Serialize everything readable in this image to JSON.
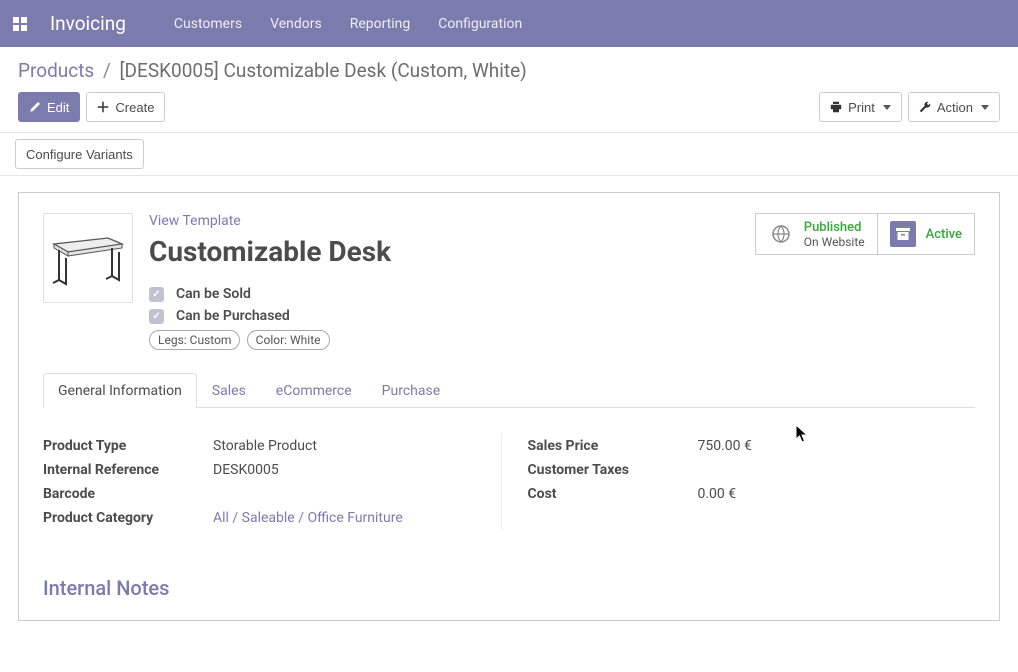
{
  "nav": {
    "brand": "Invoicing",
    "items": [
      "Customers",
      "Vendors",
      "Reporting",
      "Configuration"
    ]
  },
  "breadcrumb": {
    "parent": "Products",
    "current": "[DESK0005] Customizable Desk (Custom, White)"
  },
  "buttons": {
    "edit": "Edit",
    "create": "Create",
    "print": "Print",
    "action": "Action",
    "configure_variants": "Configure Variants"
  },
  "product": {
    "view_template": "View Template",
    "title": "Customizable Desk",
    "can_be_sold": "Can be Sold",
    "can_be_purchased": "Can be Purchased",
    "tags": [
      "Legs: Custom",
      "Color: White"
    ]
  },
  "status": {
    "published": {
      "line1": "Published",
      "line2": "On Website"
    },
    "active": {
      "line1": "Active"
    }
  },
  "tabs": [
    "General Information",
    "Sales",
    "eCommerce",
    "Purchase"
  ],
  "fields_left": {
    "product_type": {
      "label": "Product Type",
      "value": "Storable Product"
    },
    "internal_ref": {
      "label": "Internal Reference",
      "value": "DESK0005"
    },
    "barcode": {
      "label": "Barcode",
      "value": ""
    },
    "category": {
      "label": "Product Category",
      "value": "All / Saleable / Office Furniture"
    }
  },
  "fields_right": {
    "sales_price": {
      "label": "Sales Price",
      "value": "750.00 €"
    },
    "customer_taxes": {
      "label": "Customer Taxes",
      "value": ""
    },
    "cost": {
      "label": "Cost",
      "value": "0.00 €"
    }
  },
  "section_notes": "Internal Notes"
}
